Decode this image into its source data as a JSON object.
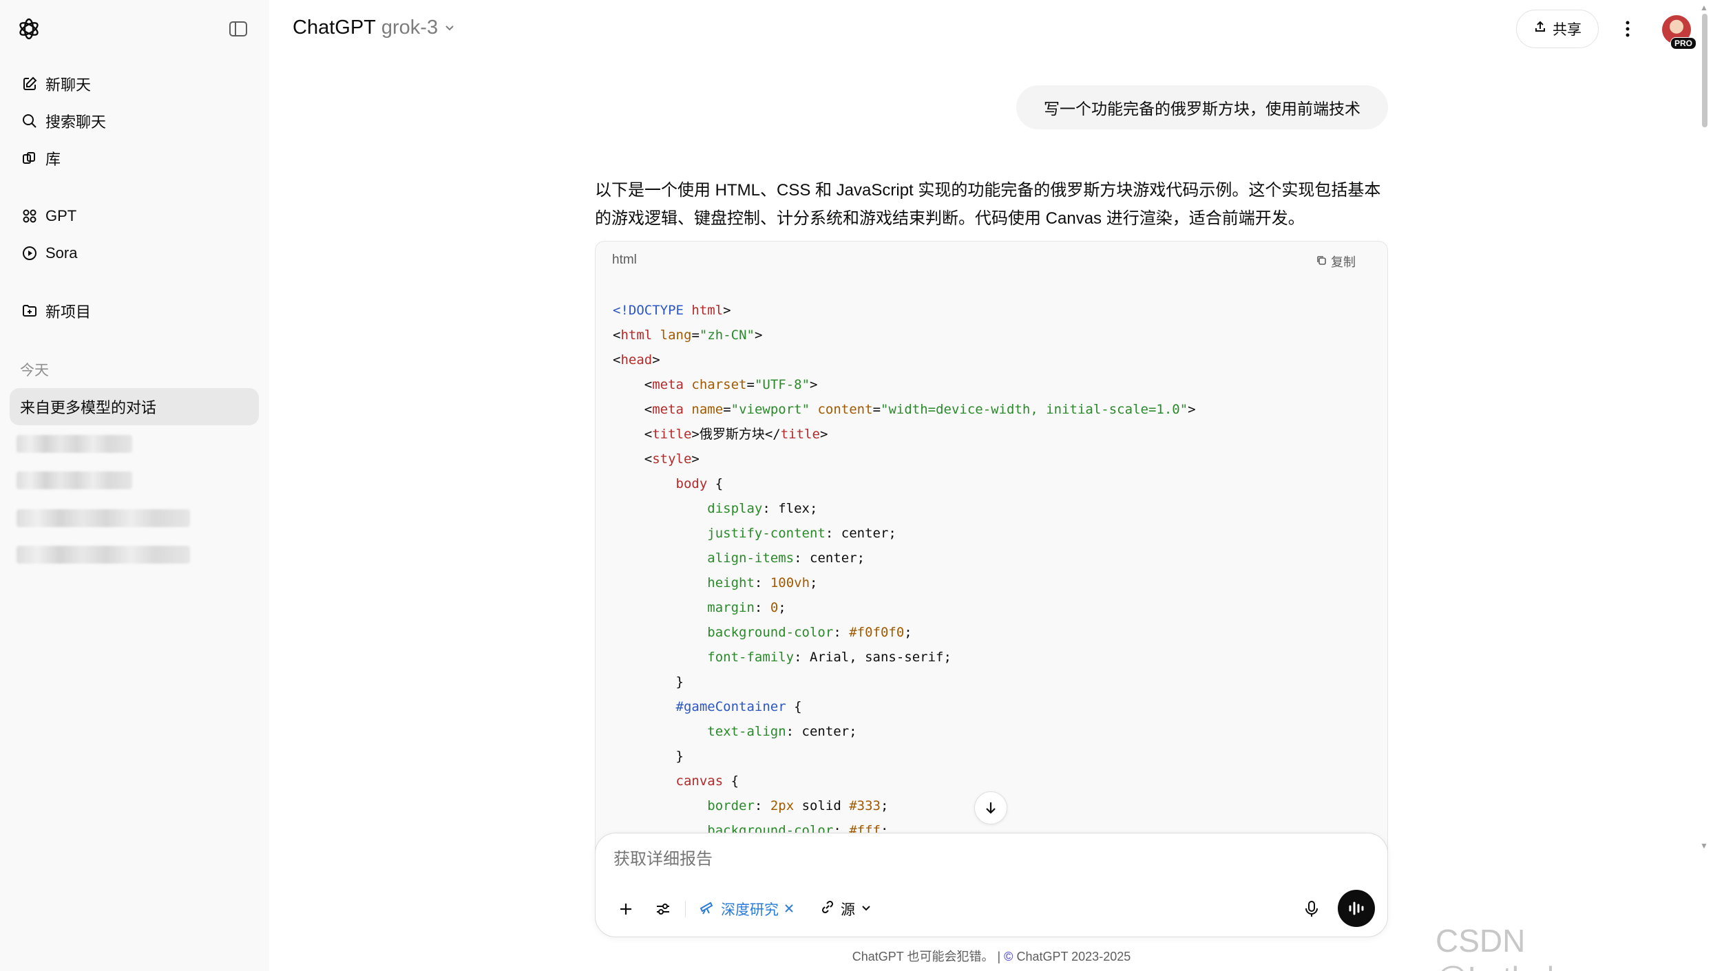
{
  "sidebar": {
    "nav": [
      {
        "label": "新聊天",
        "icon": "edit-icon"
      },
      {
        "label": "搜索聊天",
        "icon": "search-icon"
      },
      {
        "label": "库",
        "icon": "library-icon"
      },
      {
        "label": "GPT",
        "icon": "grid-icon"
      },
      {
        "label": "Sora",
        "icon": "play-icon"
      },
      {
        "label": "新项目",
        "icon": "folder-plus-icon"
      }
    ],
    "section_today": "今天",
    "active_chat": "来自更多模型的对话"
  },
  "header": {
    "app_name": "ChatGPT",
    "model": "grok-3",
    "share_label": "共享",
    "pro_badge": "PRO"
  },
  "chat": {
    "user_message": "写一个功能完备的俄罗斯方块，使用前端技术",
    "assistant_intro": "以下是一个使用 HTML、CSS 和 JavaScript 实现的功能完备的俄罗斯方块游戏代码示例。这个实现包括基本的游戏逻辑、键盘控制、计分系统和游戏结束判断。代码使用 Canvas 进行渲染，适合前端开发。",
    "code_lang": "html",
    "copy_label": "复制"
  },
  "composer": {
    "placeholder": "获取详细报告",
    "deep_research_label": "深度研究",
    "source_label": "源"
  },
  "footer": {
    "disclaimer": "ChatGPT 也可能会犯错。",
    "copyright": "ChatGPT 2023-2025"
  },
  "watermark": "CSDN @Lethehong",
  "colors": {
    "accent_blue": "#2b7bd8",
    "sidebar_bg": "#f9f9f9",
    "code_bg": "#f9f9f9"
  }
}
